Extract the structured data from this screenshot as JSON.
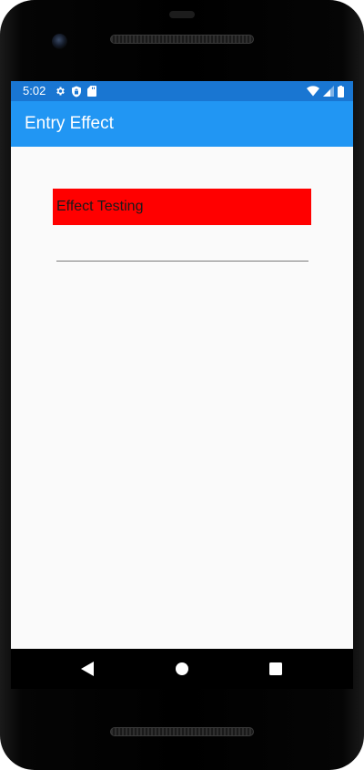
{
  "status_bar": {
    "time": "5:02",
    "left_icons": [
      "gear-icon",
      "shield-icon",
      "sd-card-icon"
    ],
    "right_icons": [
      "wifi-icon",
      "cell-signal-icon",
      "battery-icon"
    ]
  },
  "app_bar": {
    "title": "Entry Effect"
  },
  "main": {
    "entry_text": "Effect Testing",
    "entry_background": "#ff0000",
    "second_entry_value": ""
  },
  "nav_bar": {
    "buttons": [
      "back-icon",
      "home-icon",
      "recents-icon"
    ]
  },
  "colors": {
    "status_bar": "#1976d2",
    "app_bar": "#2196f3",
    "page_background": "#fafafa"
  }
}
